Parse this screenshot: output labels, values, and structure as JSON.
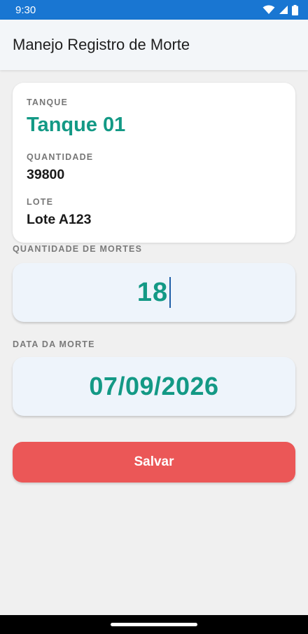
{
  "status_bar": {
    "time": "9:30",
    "icons": [
      "wifi-icon",
      "cellular-signal-icon",
      "battery-icon"
    ]
  },
  "app_bar": {
    "title": "Manejo Registro de Morte"
  },
  "info_card": {
    "tank_label": "TANQUE",
    "tank_value": "Tanque 01",
    "quantity_label": "QUANTIDADE",
    "quantity_value": "39800",
    "lot_label": "LOTE",
    "lot_value": "Lote A123"
  },
  "deaths": {
    "label": "QUANTIDADE DE MORTES",
    "value": "18"
  },
  "death_date": {
    "label": "DATA DA MORTE",
    "value": "07/09/2026"
  },
  "actions": {
    "save_label": "Salvar"
  },
  "colors": {
    "status_bar": "#1976d2",
    "accent": "#139985",
    "save_button": "#eb5757",
    "input_background": "#eef4fb"
  }
}
